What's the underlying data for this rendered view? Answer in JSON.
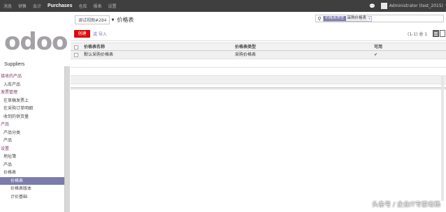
{
  "topbar": {
    "menu": [
      "消息",
      "销售",
      "会计",
      "Purchases",
      "仓库",
      "报表",
      "设置"
    ],
    "active_index": 3,
    "user": "Administrator (test_2015)"
  },
  "sidebar": {
    "logo_text": "odoo",
    "app_name": "Suppliers",
    "items": [
      {
        "label": "接收的产品",
        "kind": "hdr"
      },
      {
        "label": "入库产品",
        "kind": "it"
      },
      {
        "label": "发票管理",
        "kind": "hdr"
      },
      {
        "label": "在草稿发票上",
        "kind": "it"
      },
      {
        "label": "在采购订单明细",
        "kind": "it"
      },
      {
        "label": "收到的供货量",
        "kind": "it"
      },
      {
        "label": "产品",
        "kind": "hdr"
      },
      {
        "label": "产品分类",
        "kind": "it"
      },
      {
        "label": "产品",
        "kind": "it"
      },
      {
        "label": "设置",
        "kind": "hdr"
      },
      {
        "label": "地址簿",
        "kind": "it"
      },
      {
        "label": "产品",
        "kind": "it"
      },
      {
        "label": "价格表",
        "kind": "it"
      },
      {
        "label": "价格表",
        "kind": "sel"
      },
      {
        "label": "价格表版本",
        "kind": "sub"
      },
      {
        "label": "计价基础",
        "kind": "sub"
      }
    ]
  },
  "control_panel": {
    "view_selector": "调试视图#284",
    "title": "价格表",
    "create_label": "创建",
    "import_label": "或 导入",
    "search": {
      "facet_label": "价格表类型",
      "facet_value": "采购价格表",
      "facet_remove": "x"
    },
    "pager": "(1-1) 总 1"
  },
  "table": {
    "columns": [
      "价格表名称",
      "价格表类型",
      "可用"
    ],
    "rows": [
      {
        "name": "默认采购价格表",
        "type": "采购价格表",
        "active": "✔"
      }
    ]
  },
  "watermark": "头条号 / 企业IT专家老杨"
}
